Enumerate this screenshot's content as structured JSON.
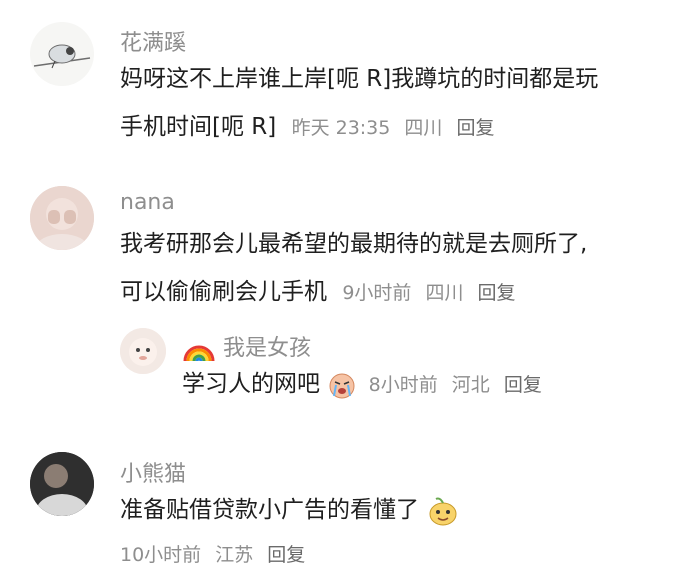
{
  "comments": [
    {
      "username": "花满蹊",
      "line1": "妈呀这不上岸谁上岸[呃 R]我蹲坑的时间都是玩",
      "line2": "手机时间[呃 R]",
      "time": "昨天 23:35",
      "location": "四川",
      "reply_label": "回复"
    },
    {
      "username": "nana",
      "line1": "我考研那会儿最希望的最期待的就是去厕所了,",
      "line2": "可以偷偷刷会儿手机",
      "time": "9小时前",
      "location": "四川",
      "reply_label": "回复",
      "sub_reply": {
        "username": "我是女孩",
        "text": "学习人的网吧",
        "time": "8小时前",
        "location": "河北",
        "reply_label": "回复"
      }
    },
    {
      "username": "小熊猫",
      "line1": "准备贴借贷款小广告的看懂了",
      "time": "10小时前",
      "location": "江苏",
      "reply_label": "回复"
    }
  ],
  "colors": {
    "username": "#8e8e8e",
    "text": "#1f1f1f",
    "meta": "#8e8e8e"
  }
}
